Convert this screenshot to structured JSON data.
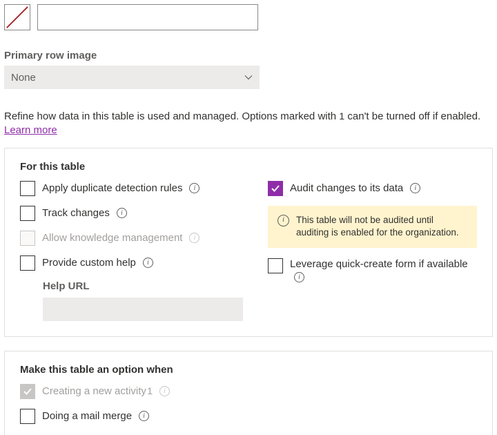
{
  "top": {
    "text_value": ""
  },
  "primary_image": {
    "label": "Primary row image",
    "value": "None"
  },
  "refine": {
    "text_before_sup": "Refine how data in this table is used and managed. Options marked with ",
    "sup": "1",
    "text_after_sup": " can't be turned off if enabled. ",
    "link": "Learn more"
  },
  "section1": {
    "title": "For this table",
    "left": {
      "apply_dup": "Apply duplicate detection rules",
      "track_changes": "Track changes",
      "allow_km": "Allow knowledge management",
      "custom_help": "Provide custom help",
      "help_url_label": "Help URL"
    },
    "right": {
      "audit": "Audit changes to its data",
      "audit_warning": "This table will not be audited until auditing is enabled for the organization.",
      "leverage_qc": "Leverage quick-create form if available"
    }
  },
  "section2": {
    "title": "Make this table an option when",
    "creating_activity": "Creating a new activity",
    "creating_activity_sup": "1",
    "mail_merge": "Doing a mail merge"
  }
}
